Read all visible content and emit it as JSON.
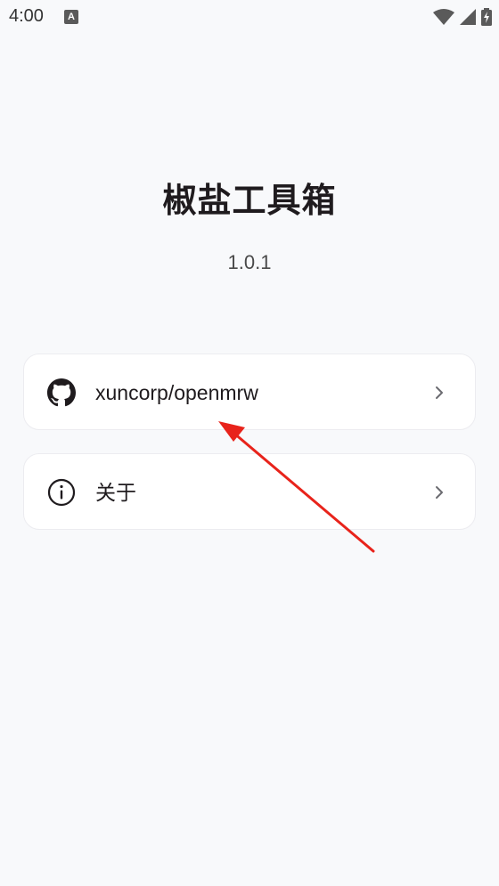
{
  "status_bar": {
    "time": "4:00",
    "notification_glyph": "A",
    "icons": [
      "wifi-icon",
      "cell-signal-icon",
      "battery-charging-icon"
    ]
  },
  "header": {
    "title": "椒盐工具箱",
    "version": "1.0.1"
  },
  "menu": {
    "items": [
      {
        "label": "xuncorp/openmrw",
        "icon": "github-icon",
        "trailing": "chevron-right-icon"
      },
      {
        "label": "关于",
        "icon": "info-icon",
        "trailing": "chevron-right-icon"
      }
    ]
  },
  "colors": {
    "background": "#f8f9fb",
    "card": "#ffffff",
    "text": "#1f1b1e",
    "annotation_arrow": "#e8231b"
  }
}
